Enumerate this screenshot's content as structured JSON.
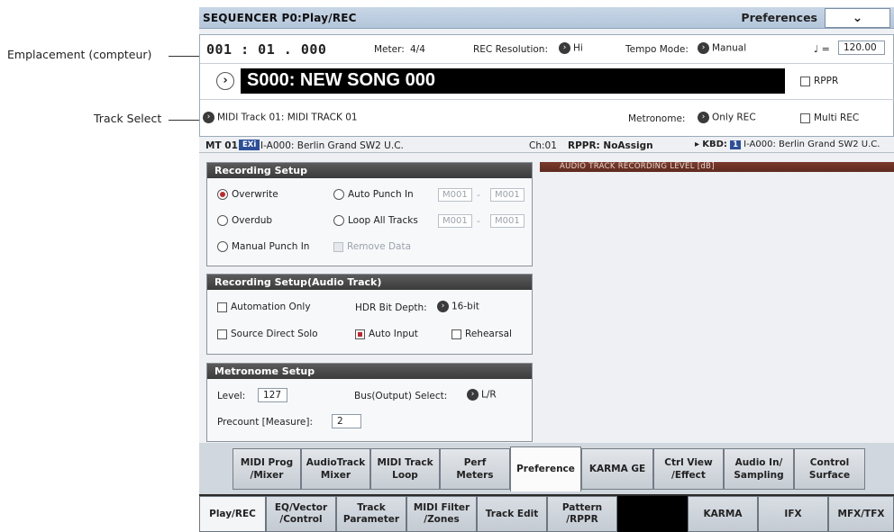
{
  "callouts": {
    "position": "Emplacement (compteur)",
    "track_select": "Track Select"
  },
  "title_bar": {
    "title": "SEQUENCER P0:Play/REC",
    "preferences": "Preferences",
    "dropdown_glyph": "⌄"
  },
  "locate": {
    "value": "001 : 01 . 000",
    "meter_label": "Meter:",
    "meter_value": "4/4",
    "rec_res_label": "REC Resolution:",
    "rec_res_value": "Hi",
    "tempo_mode_label": "Tempo Mode:",
    "tempo_mode_value": "Manual",
    "tempo_symbol": "♩ =",
    "tempo_value": "120.00"
  },
  "song": {
    "name": "S000: NEW SONG 000",
    "rppr_label": "RPPR"
  },
  "track": {
    "select": "MIDI Track 01: MIDI TRACK 01",
    "metronome_label": "Metronome:",
    "metronome_value": "Only REC",
    "multi_rec_label": "Multi REC"
  },
  "info_bar": {
    "mt": "MT 01:",
    "exi_badge": "EXi",
    "program": "I-A000: Berlin Grand SW2 U.C.",
    "ch": "Ch:01",
    "rppr": "RPPR: NoAssign",
    "kbd_label": "KBD:",
    "kbd_badge": "1",
    "kbd_program": "I-A000: Berlin Grand SW2 U.C."
  },
  "recording_setup": {
    "title": "Recording Setup",
    "overwrite": "Overwrite",
    "overdub": "Overdub",
    "manual_punch": "Manual Punch In",
    "auto_punch": "Auto Punch In",
    "loop_all": "Loop All Tracks",
    "remove_data": "Remove Data",
    "m_from": "M001",
    "m_to": "M001",
    "dash": "-"
  },
  "audio_setup": {
    "title": "Recording Setup(Audio Track)",
    "automation_only": "Automation Only",
    "hdr_label": "HDR Bit Depth:",
    "hdr_value": "16-bit",
    "source_direct": "Source Direct Solo",
    "auto_input": "Auto Input",
    "rehearsal": "Rehearsal"
  },
  "metronome_setup": {
    "title": "Metronome Setup",
    "level_label": "Level:",
    "level_value": "127",
    "bus_label": "Bus(Output) Select:",
    "bus_value": "L/R",
    "precount_label": "Precount [Measure]:",
    "precount_value": "2"
  },
  "level_meter": {
    "label": "AUDIO TRACK RECORDING LEVEL [dB]"
  },
  "upper_tabs": [
    {
      "l1": "MIDI Prog",
      "l2": "/Mixer"
    },
    {
      "l1": "AudioTrack",
      "l2": "Mixer"
    },
    {
      "l1": "MIDI Track",
      "l2": "Loop"
    },
    {
      "l1": "Perf",
      "l2": "Meters"
    },
    {
      "l1": "Preference",
      "l2": ""
    },
    {
      "l1": "KARMA GE",
      "l2": ""
    },
    {
      "l1": "Ctrl View",
      "l2": "/Effect"
    },
    {
      "l1": "Audio In/",
      "l2": "Sampling"
    },
    {
      "l1": "Control",
      "l2": "Surface"
    }
  ],
  "lower_tabs": [
    {
      "l1": "Play/REC",
      "l2": ""
    },
    {
      "l1": "EQ/Vector",
      "l2": "/Control"
    },
    {
      "l1": "Track",
      "l2": "Parameter"
    },
    {
      "l1": "MIDI Filter",
      "l2": "/Zones"
    },
    {
      "l1": "Track Edit",
      "l2": ""
    },
    {
      "l1": "Pattern",
      "l2": "/RPPR"
    },
    {
      "l1": "",
      "l2": ""
    },
    {
      "l1": "KARMA",
      "l2": ""
    },
    {
      "l1": "IFX",
      "l2": ""
    },
    {
      "l1": "MFX/TFX",
      "l2": ""
    }
  ]
}
